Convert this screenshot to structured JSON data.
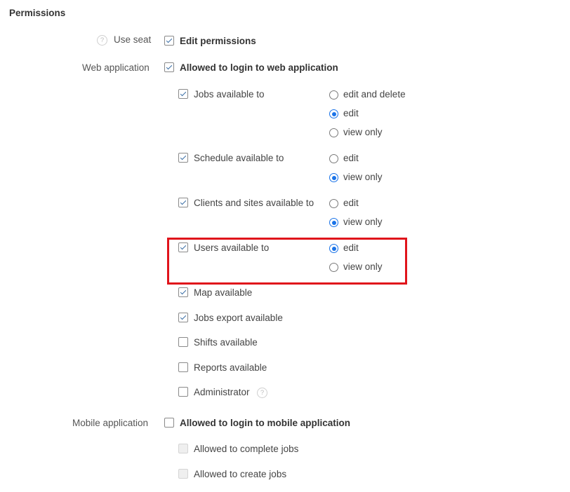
{
  "section_title": "Permissions",
  "use_seat": {
    "label": "Use seat",
    "help_icon": "question-icon",
    "checkbox_label": "Edit permissions",
    "checked": true
  },
  "web_application": {
    "label": "Web application",
    "checkbox_label": "Allowed to login to web application",
    "checked": true,
    "permissions": [
      {
        "label": "Jobs available to",
        "checked": true,
        "options": [
          "edit and delete",
          "edit",
          "view only"
        ],
        "selected": "edit"
      },
      {
        "label": "Schedule available to",
        "checked": true,
        "options": [
          "edit",
          "view only"
        ],
        "selected": "view only"
      },
      {
        "label": "Clients and sites available to",
        "checked": true,
        "options": [
          "edit",
          "view only"
        ],
        "selected": "view only"
      },
      {
        "label": "Users available to",
        "checked": true,
        "options": [
          "edit",
          "view only"
        ],
        "selected": "edit"
      }
    ],
    "features": [
      {
        "label": "Map available",
        "checked": true
      },
      {
        "label": "Jobs export available",
        "checked": true
      },
      {
        "label": "Shifts available",
        "checked": false
      },
      {
        "label": "Reports available",
        "checked": false
      },
      {
        "label": "Administrator",
        "checked": false,
        "help_icon": "question-icon"
      }
    ]
  },
  "mobile_application": {
    "label": "Mobile application",
    "checkbox_label": "Allowed to login to mobile application",
    "checked": false,
    "sub_options": [
      {
        "label": "Allowed to complete jobs",
        "checked": false,
        "disabled": true
      },
      {
        "label": "Allowed to create jobs",
        "checked": false,
        "disabled": true
      }
    ]
  },
  "colors": {
    "accent": "#1a73e8",
    "highlight": "#e0141b",
    "check": "#3a6ea5"
  }
}
